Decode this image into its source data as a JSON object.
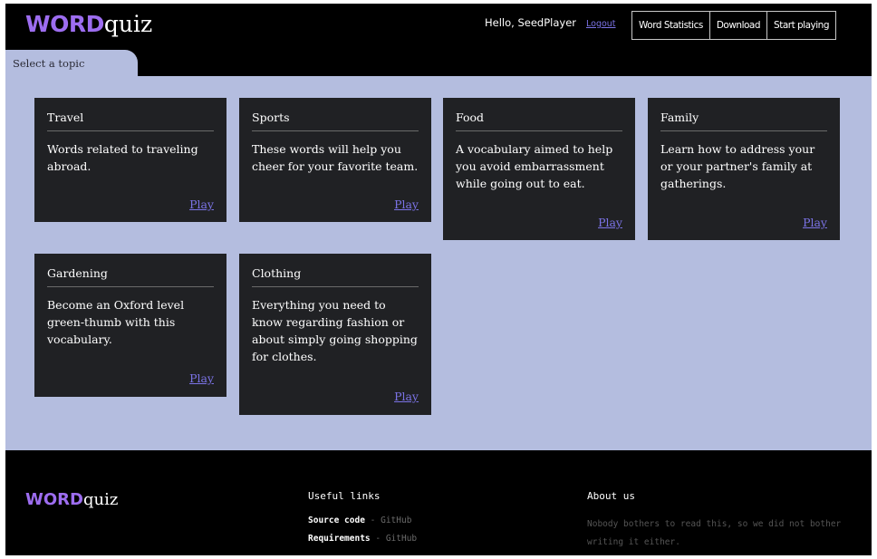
{
  "header": {
    "logo_brand": "WORD",
    "logo_rest": "quiz",
    "greeting": "Hello, SeedPlayer",
    "logout": "Logout",
    "nav": [
      {
        "label": "Word Statistics"
      },
      {
        "label": "Download"
      },
      {
        "label": "Start playing"
      }
    ],
    "topic_tab": "Select a topic"
  },
  "topics": [
    {
      "title": "Travel",
      "desc": "Words related to traveling abroad.",
      "play": "Play"
    },
    {
      "title": "Sports",
      "desc": "These words will help you cheer for your favorite team.",
      "play": "Play"
    },
    {
      "title": "Food",
      "desc": "A vocabulary aimed to help you avoid embarrassment while going out to eat.",
      "play": "Play"
    },
    {
      "title": "Family",
      "desc": "Learn how to address your or your partner's family at gatherings.",
      "play": "Play"
    },
    {
      "title": "Gardening",
      "desc": "Become an Oxford level green-thumb with this vocabulary.",
      "play": "Play"
    },
    {
      "title": "Clothing",
      "desc": "Everything you need to know regarding fashion or about simply going shopping for clothes.",
      "play": "Play"
    }
  ],
  "footer": {
    "logo_brand": "WORD",
    "logo_rest": "quiz",
    "useful_links_title": "Useful links",
    "links": [
      {
        "label": "Source code",
        "sep": " - ",
        "target": "GitHub"
      },
      {
        "label": "Requirements",
        "sep": " - ",
        "target": "GitHub"
      }
    ],
    "about_title": "About us",
    "about_text": "Nobody bothers to read this, so we did not bother writing it either."
  },
  "colors": {
    "brand": "#9d6df0",
    "background": "#b4bddf",
    "card": "#202124",
    "link": "#7b73e6"
  }
}
